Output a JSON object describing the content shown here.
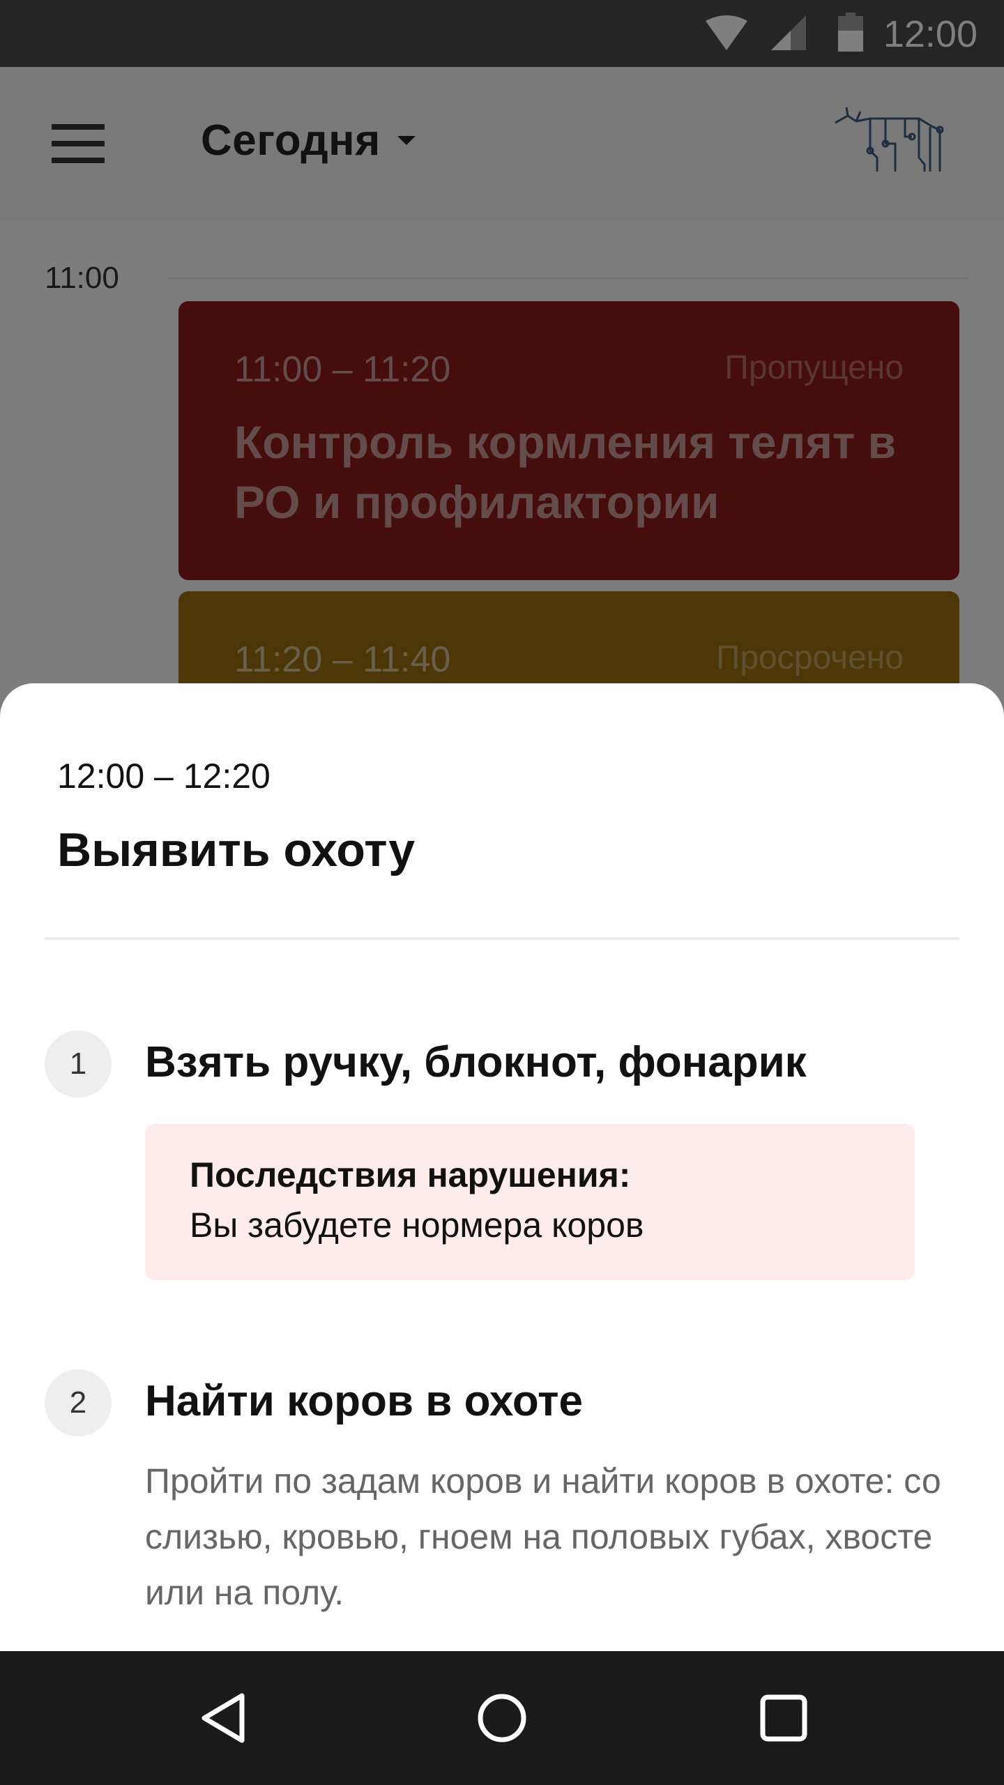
{
  "status_bar": {
    "time": "12:00",
    "icons": [
      "wifi-icon",
      "cell-signal-icon",
      "battery-icon"
    ]
  },
  "app_bar": {
    "menu_icon": "hamburger-menu-icon",
    "date_selector_label": "Сегодня",
    "logo_icon": "cow-circuit-logo-icon"
  },
  "timeline": {
    "hour_label": "11:00",
    "tasks": [
      {
        "time": "11:00 – 11:20",
        "status": "Пропущено",
        "title": "Контроль кормления телят в РО и профилактории",
        "color": "#8b1c1b"
      },
      {
        "time": "11:20 – 11:40",
        "status": "Просрочено",
        "title": "",
        "color": "#9b6f12"
      }
    ]
  },
  "bottom_sheet": {
    "time": "12:00 – 12:20",
    "title": "Выявить охоту",
    "steps": [
      {
        "number": "1",
        "title": "Взять ручку, блокнот, фонарик",
        "warning_title": "Последствия нарушения:",
        "warning_text": "Вы забудете нормера коров"
      },
      {
        "number": "2",
        "title": "Найти коров в охоте",
        "description": "Пройти по задам коров и найти коров в охоте: со слизью, кровью, гноем на половых губах, хвосте или на полу."
      }
    ]
  },
  "nav_bar": {
    "buttons": [
      "back-icon",
      "home-icon",
      "recents-icon"
    ]
  }
}
